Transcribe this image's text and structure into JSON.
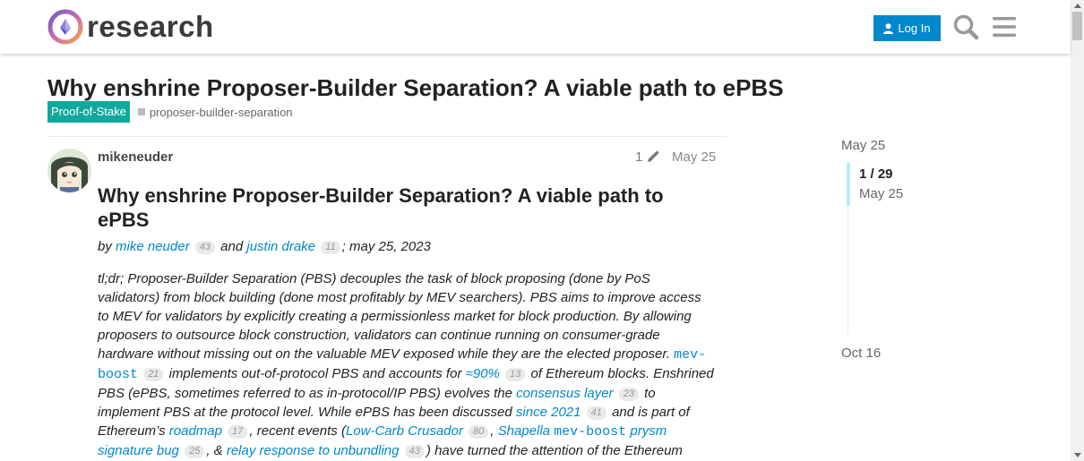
{
  "header": {
    "logo_text": "research",
    "login_label": "Log In"
  },
  "topic": {
    "title": "Why enshrine Proposer-Builder Separation? A viable path to ePBS",
    "category": "Proof-of-Stake",
    "tag": "proposer-builder-separation"
  },
  "post": {
    "username": "mikeneuder",
    "edit_count": "1",
    "date": "May 25",
    "heading": "Why enshrine Proposer-Builder Separation? A viable path to ePBS",
    "byline": {
      "by": "by",
      "author1": "mike neuder",
      "author1_clicks": "43",
      "and": "and",
      "author2": "justin drake",
      "author2_clicks": "11",
      "date": "; may 25, 2023"
    },
    "body": {
      "t1": "tl;dr; Proposer-Builder Separation (PBS) decouples the task of block proposing (done by PoS validators) from block building (done most profitably by MEV searchers). PBS aims to improve access to MEV for validators by explicitly creating a permissionless market for block production. By allowing proposers to outsource block construction, validators can continue running on consumer-grade hardware without missing out on the valuable MEV exposed while they are the elected proposer. ",
      "l1": "mev-boost",
      "c1": "21",
      "t2": " implements out-of-protocol PBS and accounts for ",
      "l2": "≈90%",
      "c2": "13",
      "t3": " of Ethereum blocks. Enshrined PBS (ePBS, sometimes referred to as in-protocol/IP PBS) evolves the ",
      "l3": "consensus layer",
      "c3": "23",
      "t4": " to implement PBS at the protocol level. While ePBS has been discussed ",
      "l4": "since 2021",
      "c4": "41",
      "t5": " and is part of Ethereum’s ",
      "l5": "roadmap",
      "c5": "17",
      "t6": ", recent events (",
      "l6": "Low-Carb Crusador",
      "c6": "80",
      "t7": ", ",
      "l7a": "Shapella ",
      "l7b": "mev-boost",
      "l7c": " prysm signature bug",
      "c7": "25",
      "t8": ", & ",
      "l8": "relay response to unbundling",
      "c8": "43",
      "t9": ") have turned the attention of the Ethereum"
    }
  },
  "timeline": {
    "top_date": "May 25",
    "count": "1 / 29",
    "current_date": "May 25",
    "bottom_date": "Oct 16"
  },
  "colors": {
    "accent": "#0088cc",
    "category": "#12a89d"
  }
}
